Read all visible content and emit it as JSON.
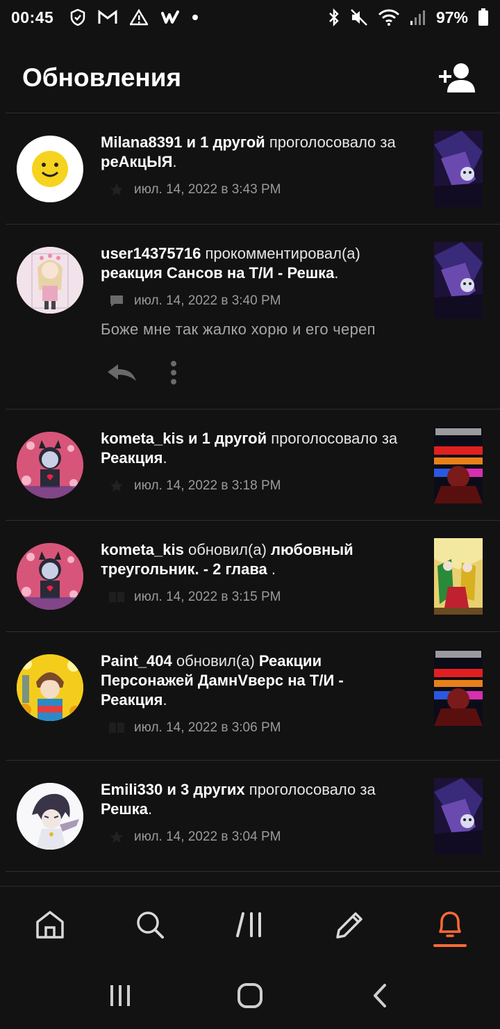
{
  "status_bar": {
    "time": "00:45",
    "battery": "97%",
    "icons_left": [
      "shield-icon",
      "gmail-icon",
      "warning-icon",
      "wattpad-icon",
      "dot-icon"
    ],
    "icons_right": [
      "bluetooth-icon",
      "mute-icon",
      "wifi-icon",
      "signal-icon",
      "battery-icon"
    ]
  },
  "header": {
    "title": "Обновления",
    "add_friend_icon": "add-user-icon"
  },
  "items": [
    {
      "user": "Milana8391 и 1 другой",
      "action": "проголосовало за",
      "target": "реАкцЫЯ",
      "suffix": ".",
      "icon": "star-icon",
      "time": "июл. 14, 2022 в 3:43 PM"
    },
    {
      "user": "user14375716",
      "action": "прокомментировал(а)",
      "target": "реакция Сансов на Т/И - Решка",
      "suffix": ".",
      "icon": "comment-icon",
      "time": "июл. 14, 2022 в 3:40 PM",
      "comment": "Боже мне так жалко хорю и его череп"
    },
    {
      "user": "kometa_kis и 1 другой",
      "action": "проголосовало за",
      "target": "Реакция",
      "suffix": ".",
      "icon": "star-icon",
      "time": "июл. 14, 2022 в 3:18 PM"
    },
    {
      "user": "kometa_kis",
      "action": "обновил(а)",
      "target": "любовный треугольник. - 2 глава",
      "suffix": " .",
      "icon": "book-icon",
      "time": "июл. 14, 2022 в 3:15 PM"
    },
    {
      "user": "Paint_404",
      "action": "обновил(а)",
      "target": "Реакции Персонажей ДамнVверс на Т/И - Реакция",
      "suffix": ".",
      "icon": "book-icon",
      "time": "июл. 14, 2022 в 3:06 PM"
    },
    {
      "user": "Emili330 и 3 других",
      "action": "проголосовало за",
      "target": "Решка",
      "suffix": ".",
      "icon": "star-icon",
      "time": "июл. 14, 2022 в 3:04 PM"
    }
  ],
  "colors": {
    "background": "#121212",
    "accent": "#ff6a36",
    "muted_text": "#9a9a9a"
  },
  "bottom_nav": [
    "home-icon",
    "search-icon",
    "library-icon",
    "write-icon",
    "notifications-icon"
  ],
  "system_nav": [
    "recents-icon",
    "home-circle-icon",
    "back-icon"
  ]
}
